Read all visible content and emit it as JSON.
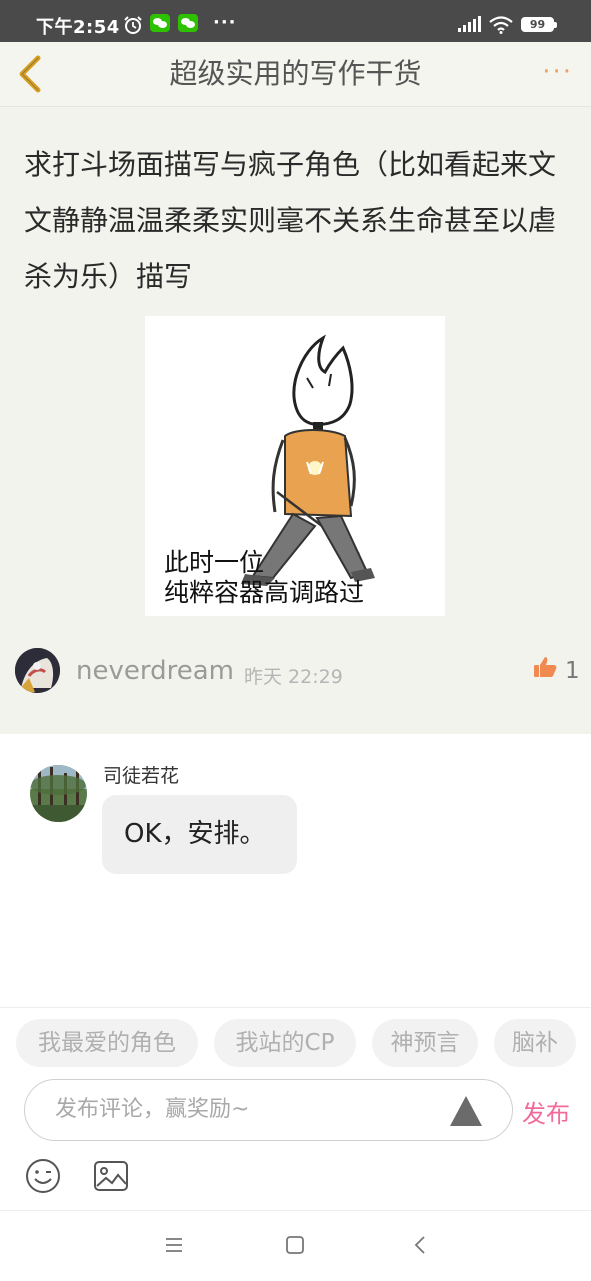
{
  "status_bar": {
    "time": "下午2:54",
    "more": "···",
    "battery": "99"
  },
  "header": {
    "title": "超级实用的写作干货",
    "more_label": "···"
  },
  "post": {
    "text": "求打斗场面描写与疯子角色（比如看起来文文静静温温柔柔实则毫不关系生命甚至以虐杀为乐）描写",
    "image_caption_line1": "此时一位",
    "image_caption_line2": "纯粹容器高调路过",
    "author": "neverdream",
    "time": "昨天 22:29",
    "likes": "1"
  },
  "reply": {
    "author": "司徒若花",
    "text": "OK，安排。"
  },
  "composer": {
    "tags": [
      "我最爱的角色",
      "我站的CP",
      "神预言",
      "脑补"
    ],
    "placeholder": "发布评论，赢奖励~",
    "publish_label": "发布"
  },
  "colors": {
    "accent_pink": "#f06a9b",
    "like_orange": "#f08a50",
    "back_arrow": "#d8a020"
  },
  "icons": [
    "alarm-icon",
    "wechat-icon",
    "signal-icon",
    "wifi-icon",
    "battery-icon",
    "back-icon",
    "more-icon",
    "thumbs-up-icon",
    "send-arrow-icon",
    "emoji-icon",
    "image-icon",
    "menu-icon",
    "home-icon",
    "back-nav-icon"
  ]
}
